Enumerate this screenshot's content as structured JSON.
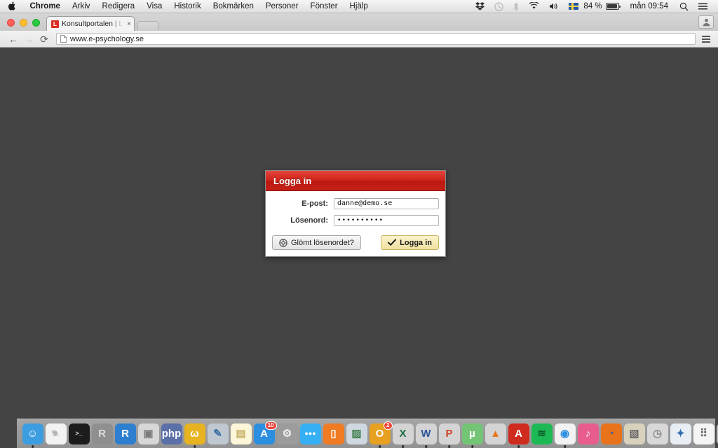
{
  "menubar": {
    "apple_icon": "apple-logo-icon",
    "items": [
      {
        "label": "Chrome",
        "bold": true
      },
      {
        "label": "Arkiv",
        "bold": false
      },
      {
        "label": "Redigera",
        "bold": false
      },
      {
        "label": "Visa",
        "bold": false
      },
      {
        "label": "Historik",
        "bold": false
      },
      {
        "label": "Bokmärken",
        "bold": false
      },
      {
        "label": "Personer",
        "bold": false
      },
      {
        "label": "Fönster",
        "bold": false
      },
      {
        "label": "Hjälp",
        "bold": false
      }
    ],
    "status": {
      "dropbox_icon": "dropbox-icon",
      "timemachine_icon": "time-machine-icon",
      "bluetooth_icon": "bluetooth-icon",
      "wifi_icon": "wifi-icon",
      "volume_icon": "volume-icon",
      "input_flag_icon": "swedish-flag-icon",
      "battery_percent": "84 %",
      "battery_icon": "battery-icon",
      "clock": "mån 09:54",
      "search_icon": "spotlight-search-icon",
      "notifications_icon": "notification-center-icon"
    }
  },
  "browser": {
    "tab": {
      "favicon_letter": "L",
      "title": "Konsultportalen | Ledarsk",
      "close_label": "×"
    },
    "new_tab_label": "",
    "profile_icon": "user-profile-icon",
    "toolbar": {
      "back_label": "←",
      "forward_label": "→",
      "reload_label": "⟳",
      "url": "www.e-psychology.se",
      "page_icon": "page-document-icon",
      "menu_icon": "hamburger-menu-icon"
    }
  },
  "page": {
    "background_color": "#444444",
    "login": {
      "title": "Logga in",
      "header_color": "#c8211a",
      "fields": [
        {
          "label": "E-post:",
          "value": "danne@demo.se",
          "type": "text",
          "name": "email"
        },
        {
          "label": "Lösenord:",
          "value": "••••••••••",
          "type": "password",
          "name": "password"
        }
      ],
      "forgot_button": {
        "label": "Glömt lösenordet?",
        "icon": "lifebuoy-help-icon"
      },
      "submit_button": {
        "label": "Logga in",
        "icon": "checkmark-icon",
        "color": "#f3e3a5"
      }
    }
  },
  "dock": {
    "items": [
      {
        "name": "finder",
        "label": "",
        "bg": "#3c9de0",
        "fg": "#ffffff",
        "glyph": "☺",
        "running": true
      },
      {
        "name": "mamp",
        "label": "",
        "bg": "#f2f2f2",
        "fg": "#6b6b6b",
        "glyph": "🐘",
        "running": false
      },
      {
        "name": "terminal",
        "label": "",
        "bg": "#1c1c1c",
        "fg": "#dddddd",
        "glyph": ">_",
        "running": false
      },
      {
        "name": "r-console",
        "label": "R",
        "bg": "#8f8f8f",
        "fg": "#dcdcdc",
        "glyph": "",
        "running": false
      },
      {
        "name": "rstudio",
        "label": "R",
        "bg": "#2f7fd0",
        "fg": "#ffffff",
        "glyph": "",
        "running": false
      },
      {
        "name": "virtualbox",
        "label": "",
        "bg": "#d7d7d7",
        "fg": "#7a7a7a",
        "glyph": "▣",
        "running": false
      },
      {
        "name": "php-storm",
        "label": "php",
        "bg": "#5b6fa8",
        "fg": "#ffffff",
        "glyph": "",
        "running": false
      },
      {
        "name": "wampserver",
        "label": "",
        "bg": "#e8b320",
        "fg": "#ffffff",
        "glyph": "ω",
        "running": true
      },
      {
        "name": "photoshop-brushes",
        "label": "",
        "bg": "#bfc8d0",
        "fg": "#3a6ea5",
        "glyph": "✎",
        "running": false
      },
      {
        "name": "notes",
        "label": "",
        "bg": "#fdf6d8",
        "fg": "#c8b26a",
        "glyph": "▤",
        "running": false
      },
      {
        "name": "app-store",
        "label": "A",
        "bg": "#2d8fe0",
        "fg": "#ffffff",
        "glyph": "",
        "badge": "10",
        "running": false
      },
      {
        "name": "system-preferences",
        "label": "",
        "bg": "#9c9c9c",
        "fg": "#eeeeee",
        "glyph": "⚙",
        "running": false
      },
      {
        "name": "messages",
        "label": "",
        "bg": "#35b0f5",
        "fg": "#ffffff",
        "glyph": "●●●",
        "running": false
      },
      {
        "name": "ibooks",
        "label": "",
        "bg": "#f07b22",
        "fg": "#ffffff",
        "glyph": "▯",
        "running": false
      },
      {
        "name": "preview",
        "label": "",
        "bg": "#cfd8e0",
        "fg": "#3f7f4f",
        "glyph": "▨",
        "running": false
      },
      {
        "name": "outlook",
        "label": "O",
        "bg": "#e8a020",
        "fg": "#ffffff",
        "glyph": "",
        "badge": "2",
        "running": true
      },
      {
        "name": "excel",
        "label": "X",
        "bg": "#d4d4d4",
        "fg": "#1d7044",
        "glyph": "",
        "running": true
      },
      {
        "name": "word",
        "label": "W",
        "bg": "#d4d4d4",
        "fg": "#2a5699",
        "glyph": "",
        "running": true
      },
      {
        "name": "powerpoint",
        "label": "P",
        "bg": "#d4d4d4",
        "fg": "#d04423",
        "glyph": "",
        "running": true
      },
      {
        "name": "utorrent",
        "label": "µ",
        "bg": "#74c476",
        "fg": "#ffffff",
        "glyph": "",
        "running": true
      },
      {
        "name": "vlc",
        "label": "",
        "bg": "#d4d4d4",
        "fg": "#e8761a",
        "glyph": "▲",
        "running": false
      },
      {
        "name": "acrobat",
        "label": "",
        "bg": "#cf2b1f",
        "fg": "#ffffff",
        "glyph": "A",
        "running": true
      },
      {
        "name": "spotify",
        "label": "",
        "bg": "#1db954",
        "fg": "#0c5c2a",
        "glyph": "≋",
        "running": false
      },
      {
        "name": "chrome",
        "label": "",
        "bg": "#f2f2f2",
        "fg": "#2d8fe0",
        "glyph": "◉",
        "running": true
      },
      {
        "name": "itunes",
        "label": "",
        "bg": "#e85c8e",
        "fg": "#ffffff",
        "glyph": "♪",
        "running": false
      },
      {
        "name": "firefox",
        "label": "",
        "bg": "#e8731a",
        "fg": "#2d5fa8",
        "glyph": "◔",
        "running": false
      },
      {
        "name": "system-utility",
        "label": "",
        "bg": "#d8d2bd",
        "fg": "#6b6b6b",
        "glyph": "▧",
        "running": false
      },
      {
        "name": "dashboard",
        "label": "",
        "bg": "#d8d8d8",
        "fg": "#8a8a8a",
        "glyph": "◷",
        "running": false
      },
      {
        "name": "safari",
        "label": "",
        "bg": "#e8eef4",
        "fg": "#2d6fb0",
        "glyph": "✦",
        "running": false
      },
      {
        "name": "launchpad",
        "label": "",
        "bg": "#f4f4f4",
        "fg": "#666666",
        "glyph": "⠿",
        "running": false
      },
      {
        "name": "installer",
        "label": "",
        "bg": "#b9bfc4",
        "fg": "#6e7478",
        "glyph": "⬇",
        "running": false
      },
      {
        "name": "vanilla",
        "label": "★",
        "bg": "#d42c2c",
        "fg": "#ffffff",
        "glyph": "",
        "running": true
      }
    ],
    "right_items": [
      {
        "name": "document-stack",
        "bg": "#fbfbfb",
        "fg": "#aaaaaa",
        "glyph": "▭"
      },
      {
        "name": "downloads-window",
        "bg": "#dfe7ef",
        "fg": "#4a7fbf",
        "glyph": "▤"
      },
      {
        "name": "documents-window",
        "bg": "#eceae0",
        "fg": "#c8a43a",
        "glyph": "▥"
      },
      {
        "name": "trash",
        "bg": "#cfd3d6",
        "fg": "#6f7478",
        "glyph": "🗑"
      }
    ]
  }
}
